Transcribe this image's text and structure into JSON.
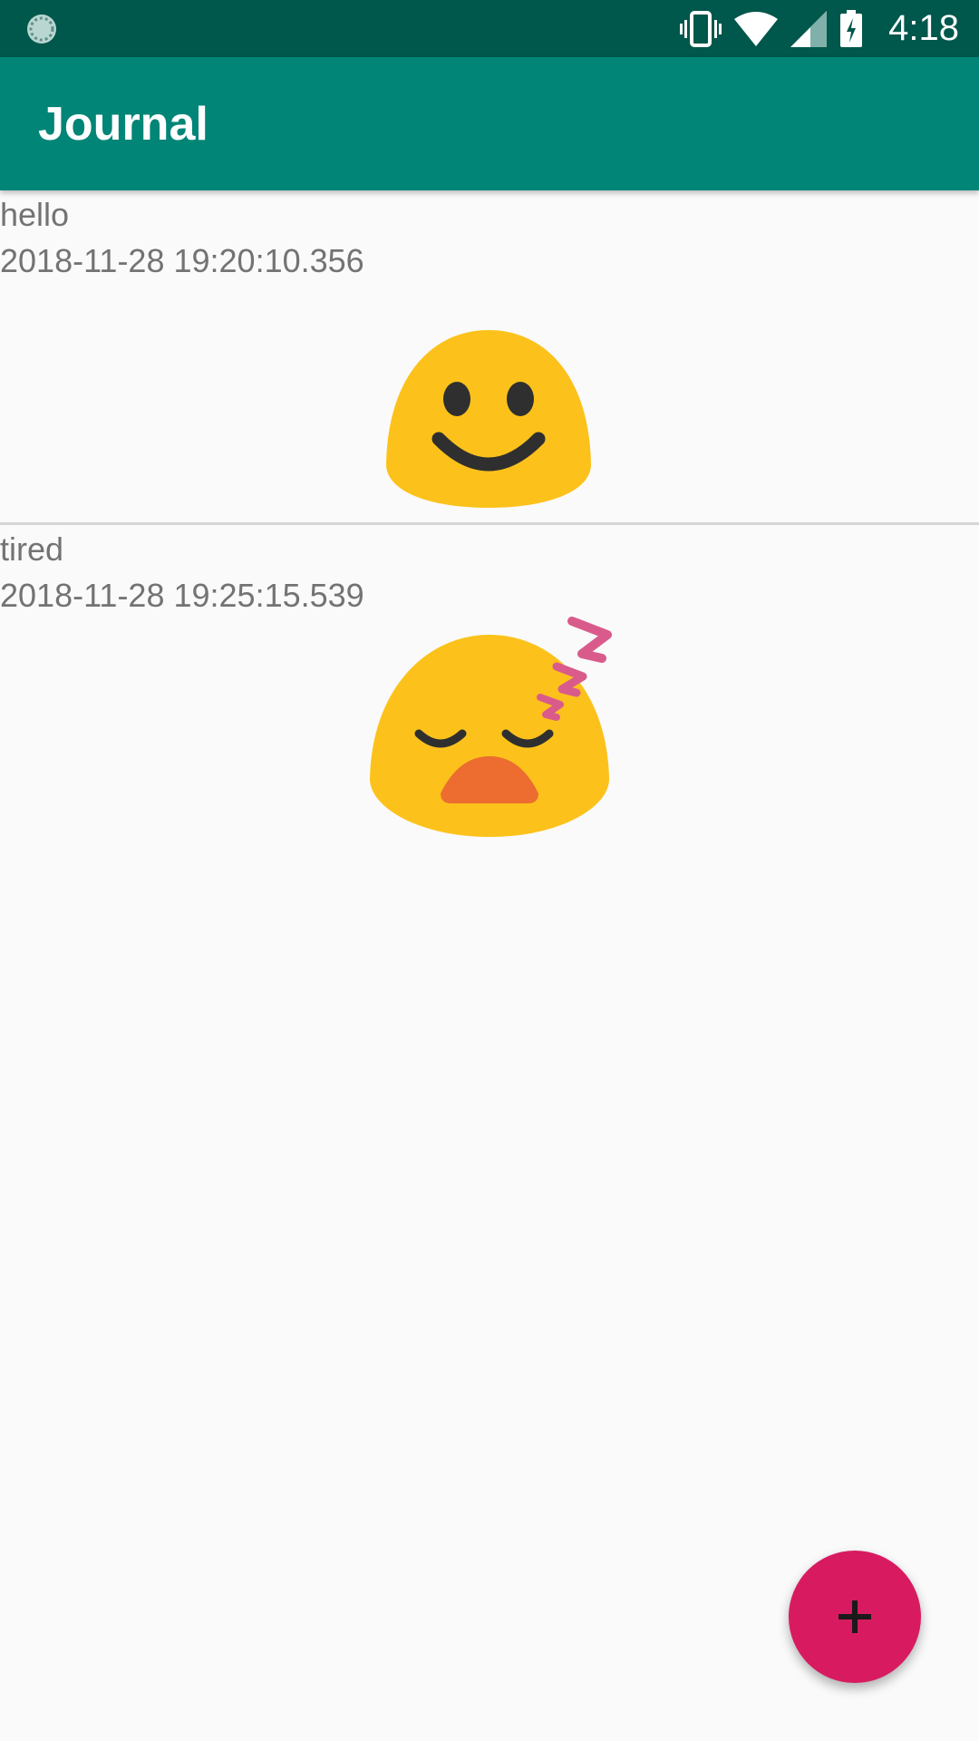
{
  "status_bar": {
    "time": "4:18",
    "icons": [
      "sync-icon",
      "vibrate-icon",
      "wifi-icon",
      "signal-icon",
      "battery-charging-icon"
    ]
  },
  "app_bar": {
    "title": "Journal"
  },
  "entries": [
    {
      "text": "hello",
      "timestamp": "2018-11-28 19:20:10.356",
      "emoji": "smiling-face-icon"
    },
    {
      "text": "tired",
      "timestamp": "2018-11-28 19:25:15.539",
      "emoji": "sleeping-face-icon"
    }
  ],
  "fab": {
    "icon": "plus-icon"
  },
  "colors": {
    "status_bar": "#00574b",
    "app_bar": "#008577",
    "accent": "#d81b60",
    "background": "#fafafa",
    "text": "#737373"
  }
}
